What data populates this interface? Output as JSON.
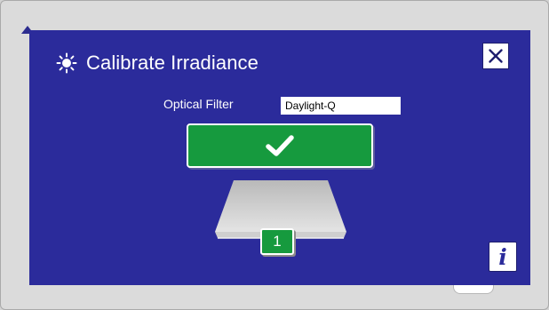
{
  "dialog": {
    "title": "Calibrate Irradiance",
    "title_icon": "sun-icon",
    "close_icon": "close-icon"
  },
  "optical_filter": {
    "label": "Optical Filter",
    "value": "Daylight-Q"
  },
  "confirm": {
    "icon": "check-icon"
  },
  "step_badge": {
    "number": "1"
  },
  "info": {
    "glyph": "i",
    "icon": "info-icon"
  },
  "colors": {
    "dialog_background": "#2b2b9b",
    "confirm_green": "#169a3e",
    "screen_background": "#dbdbdb",
    "text_white": "#ffffff"
  }
}
